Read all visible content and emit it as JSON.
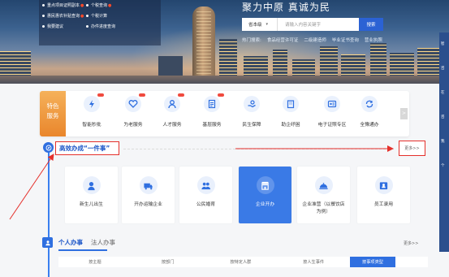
{
  "banner": {
    "slogan": "聚力中原  真诚为民",
    "news_left": [
      "重点项目证照副本",
      "惠民惠农补贴查询",
      "残疾证",
      "我要建议"
    ],
    "news_right": [
      "个税查询",
      "个税计算",
      "办件进度查询"
    ],
    "search": {
      "scope": "省本级",
      "placeholder": "请输入内容关键字",
      "button": "搜索"
    },
    "hot_label": "热门搜索:",
    "hot_items": [
      "食品经营许可证",
      "二级建造师",
      "毕业证书查询",
      "营业执照"
    ]
  },
  "side_float": [
    "智",
    "咨",
    "在",
    "咨",
    "我",
    "个"
  ],
  "features": {
    "tag": "特色\n服务",
    "items": [
      {
        "label": "智能秒批",
        "icon": "lightning-icon",
        "badge": true
      },
      {
        "label": "为老服务",
        "icon": "heart-icon",
        "badge": true
      },
      {
        "label": "人才服务",
        "icon": "user-icon",
        "badge": true
      },
      {
        "label": "基层服务",
        "icon": "document-icon",
        "badge": true
      },
      {
        "label": "民生保障",
        "icon": "hand-icon",
        "badge": false
      },
      {
        "label": "助企纾困",
        "icon": "building-icon",
        "badge": false
      },
      {
        "label": "电子证照专区",
        "icon": "id-card-icon",
        "badge": false
      },
      {
        "label": "全豫通办",
        "icon": "sync-icon",
        "badge": false
      }
    ],
    "next": ">"
  },
  "onething": {
    "title": "高效办成“一件事”",
    "more": "更多>>",
    "cards": [
      {
        "label": "新生儿出生",
        "icon": "baby-icon",
        "active": false
      },
      {
        "label": "开办运输企业",
        "icon": "truck-icon",
        "active": false
      },
      {
        "label": "公民婚育",
        "icon": "couple-icon",
        "active": false
      },
      {
        "label": "企业开办",
        "icon": "store-icon",
        "active": true
      },
      {
        "label": "企业准营（以餐饮店为例）",
        "icon": "dish-icon",
        "active": false
      },
      {
        "label": "员工录用",
        "icon": "employee-icon",
        "active": false
      }
    ]
  },
  "personal": {
    "title": "个人办事",
    "title2": "法人办事",
    "more": "更多>>",
    "tabs": [
      {
        "label": "按主题",
        "active": false
      },
      {
        "label": "按部门",
        "active": false
      },
      {
        "label": "按特定人群",
        "active": false
      },
      {
        "label": "按人生事件",
        "active": false
      },
      {
        "label": "按事项类型",
        "active": true
      }
    ]
  },
  "colors": {
    "accent": "#2f6fe0",
    "highlight": "#e5302b",
    "feature_tag": "#ee9435"
  }
}
